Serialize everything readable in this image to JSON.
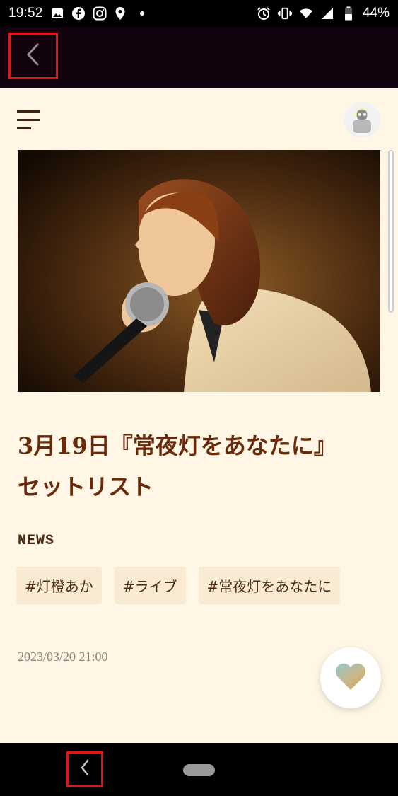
{
  "status_bar": {
    "time": "19:52",
    "battery": "44%",
    "icons": [
      "image-icon",
      "facebook-icon",
      "instagram-icon",
      "location-icon",
      "dot-icon",
      "alarm-icon",
      "vibrate-icon",
      "wifi-icon",
      "signal-icon",
      "battery-icon"
    ]
  },
  "top_bar": {
    "back_icon": "chevron-left-icon"
  },
  "header": {
    "menu_icon": "hamburger-menu-icon",
    "avatar_icon": "avatar-icon"
  },
  "article": {
    "title": "3月19日『常夜灯をあなたに』セットリスト",
    "category": "NEWS",
    "tags": [
      "#灯橙あか",
      "#ライブ",
      "#常夜灯をあなたに"
    ],
    "date": "2023/03/20 21:00"
  },
  "actions": {
    "like_icon": "heart-icon"
  },
  "colors": {
    "page_background": "#fff6e6",
    "title": "#6a2a09",
    "tag_background": "#f9ead3",
    "top_bar": "#12030f"
  }
}
